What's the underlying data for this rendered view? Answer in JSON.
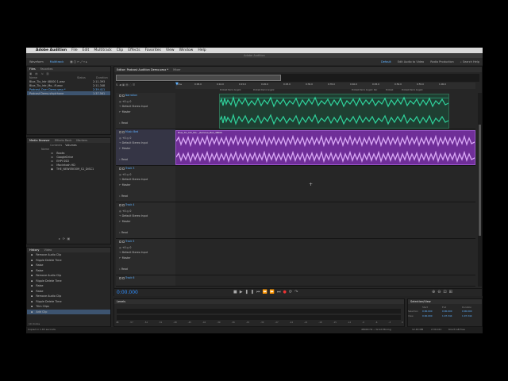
{
  "menubar": {
    "app_name": "Adobe Audition",
    "items": [
      "File",
      "Edit",
      "Multitrack",
      "Clip",
      "Effects",
      "Favorites",
      "View",
      "Window",
      "Help"
    ]
  },
  "title": "Adobe Audition",
  "toolbar": {
    "waveform": "Waveform",
    "multitrack": "Multitrack",
    "workspaces": [
      "Default",
      "Edit Audio to Video",
      "Radio Production"
    ],
    "search_placeholder": "Search Help"
  },
  "files_panel": {
    "tabs": [
      "Files",
      "Favorites"
    ],
    "columns": [
      "Name",
      "Status",
      "Duration"
    ],
    "items": [
      {
        "name": "Blue_Tix_Intr 48000 1.wav",
        "duration": "2:11.393"
      },
      {
        "name": "Blue_Tix_Intr_Mo...ff.wav",
        "duration": "2:11.348"
      },
      {
        "name": "Podcast_Over Demo.sesx *",
        "duration": "2:39.411"
      },
      {
        "name": "Podcast Demo.sfxplrhone",
        "duration": "1:37.561"
      }
    ]
  },
  "media_browser": {
    "tabs": [
      "Media Browser",
      "Effects Rack",
      "Markers"
    ],
    "contents_label": "Contents",
    "contents_value": "Volumes",
    "column_header": "Name",
    "items": [
      "Books",
      "GoogleDrive",
      "EHPI SSD",
      "Macintosh HD",
      "THE_NEWSROOM_S1_DISC1"
    ]
  },
  "history_panel": {
    "tabs": [
      "History",
      "Video"
    ],
    "items": [
      "Remove Audio Clip",
      "Ripple Delete Time",
      "Raise",
      "Raise",
      "Remove Audio Clip",
      "Ripple Delete Time",
      "Raise",
      "Raise",
      "Remove Audio Clip",
      "Ripple Delete Time",
      "Trim Clips",
      "Add Clip"
    ],
    "undo_count": "10 Undos"
  },
  "editor": {
    "tabs": [
      "Editor: Podcast Audition Demo.sesx *",
      "Mixer"
    ],
    "ruler_labels": [
      "hms",
      "0:05.0",
      "0:10.0",
      "0:15.0",
      "0:20.0",
      "0:25.0",
      "0:30.0",
      "0:35.0",
      "0:40.0",
      "0:45.0",
      "0:50.0",
      "0:55.0",
      "1:00.0"
    ],
    "markers": [
      "Podcast Demo Angelic",
      "Podcast Demo Angelic",
      "Podcast Demo Angelic",
      "Rec",
      "Podcast",
      "Podcast Demo Angelic"
    ],
    "tracks": [
      {
        "name": "Narration",
        "vol": "+0",
        "pan": "0",
        "input": "Default Stereo Input",
        "output": "Master",
        "mode": "Read"
      },
      {
        "name": "Music Bed",
        "vol": "+0",
        "pan": "0",
        "input": "Default Stereo Input",
        "output": "Master",
        "mode": "Read"
      },
      {
        "name": "Track 3",
        "vol": "+0",
        "pan": "0",
        "input": "Default Stereo Input",
        "output": "Master",
        "mode": "Read"
      },
      {
        "name": "Track 4",
        "vol": "+0",
        "pan": "0",
        "input": "Default Stereo Input",
        "output": "Master",
        "mode": "Read"
      },
      {
        "name": "Track 5",
        "vol": "+0",
        "pan": "0",
        "input": "Default Stereo Input",
        "output": "Master",
        "mode": "Read"
      },
      {
        "name": "Track 6"
      }
    ],
    "music_clip_label": "Blue_Tix_Intr_Mo..._Remove_Bed_48000"
  },
  "transport": {
    "time": "0:00.000"
  },
  "levels": {
    "title": "Levels",
    "scale": [
      "dB",
      "-57",
      "-54",
      "-51",
      "-48",
      "-45",
      "-42",
      "-39",
      "-36",
      "-33",
      "-30",
      "-27",
      "-24",
      "-21",
      "-18",
      "-15",
      "-12",
      "-9",
      "-6",
      "-3",
      "0"
    ]
  },
  "selection_view": {
    "title": "Selection/View",
    "headers": [
      "Start",
      "End",
      "Duration"
    ],
    "rows": [
      {
        "label": "Selection",
        "start": "0:00.000",
        "end": "0:00.000",
        "duration": "0:00.000"
      },
      {
        "label": "View",
        "start": "0:00.000",
        "end": "1:07.344",
        "duration": "1:07.344"
      }
    ]
  },
  "status": {
    "left": "Copied in 1.65 seconds",
    "right": [
      "48000 Hz • 32-bit Mixing",
      "12.63 MB",
      "2:39.411",
      "64.23 GB free"
    ]
  },
  "colors": {
    "accent": "#5fb1ff",
    "narration_clip": "#2fd39c",
    "music_clip": "#9b3fd8",
    "cursor_time": "#2f8fff"
  }
}
